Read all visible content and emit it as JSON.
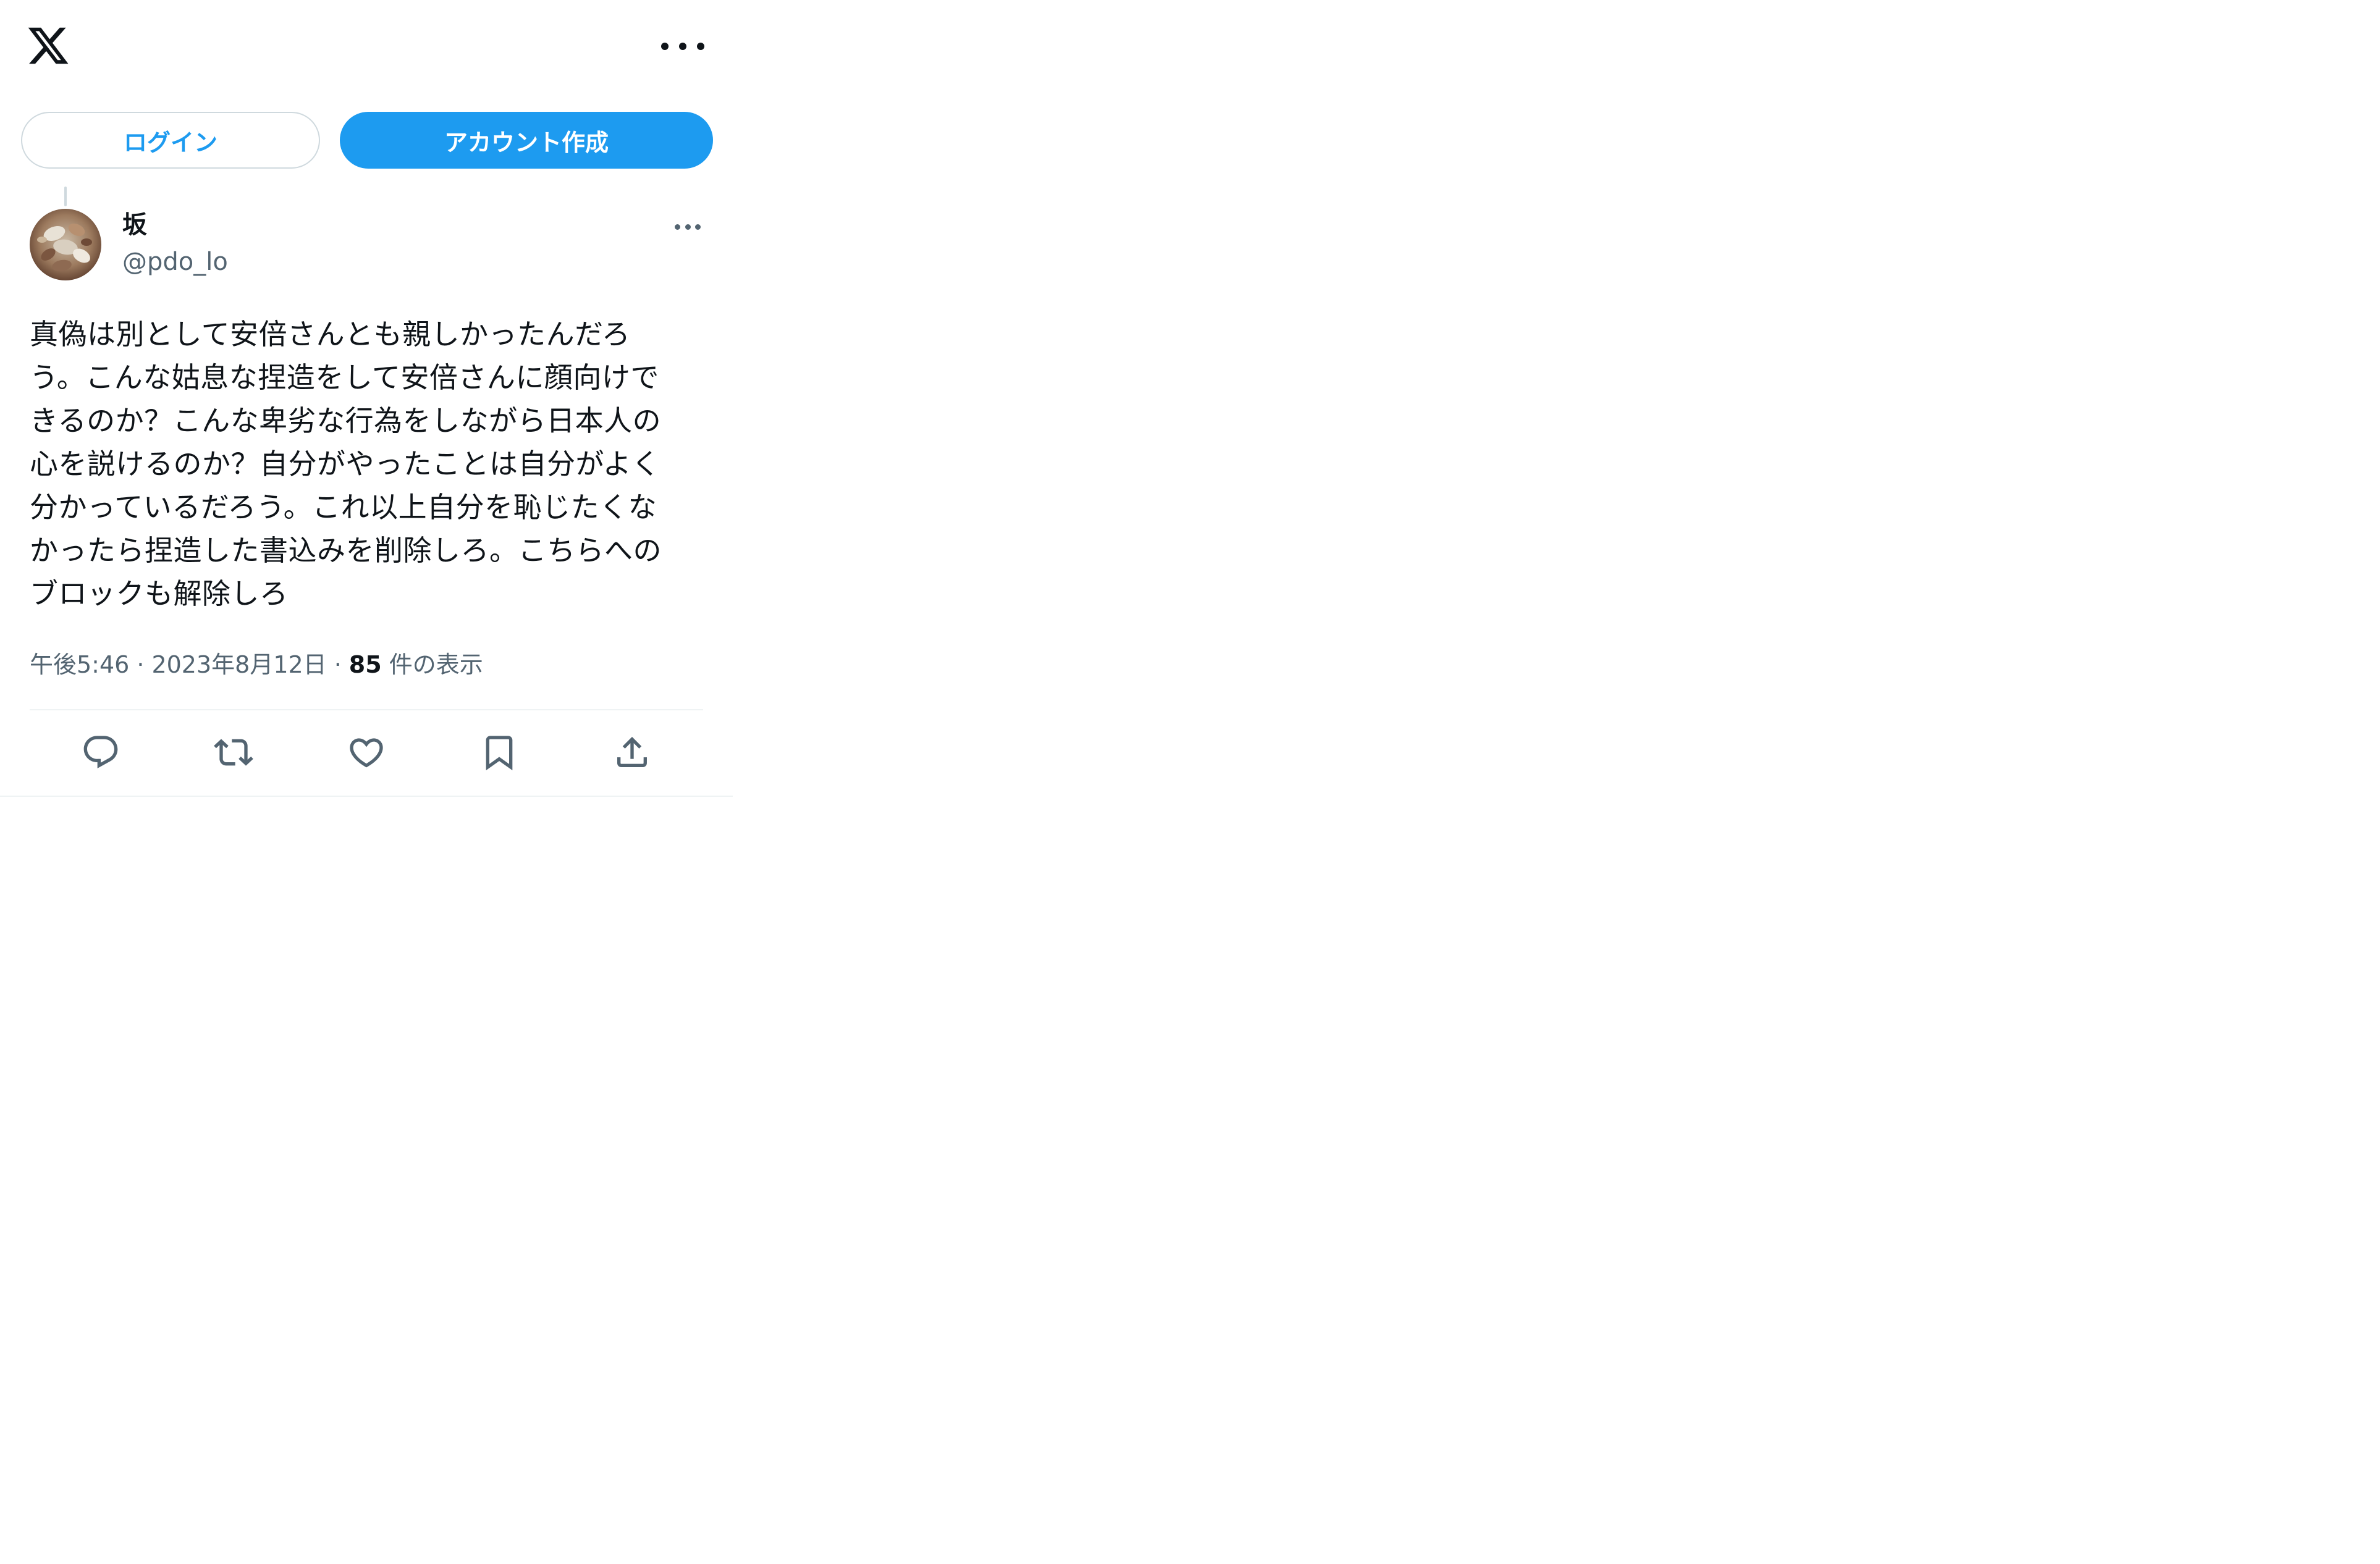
{
  "header": {
    "logo_icon": "x-logo-icon",
    "more_icon": "more-horizontal-icon"
  },
  "auth": {
    "login_label": "ログイン",
    "signup_label": "アカウント作成"
  },
  "tweet": {
    "display_name": "坂",
    "handle": "@pdo_lo",
    "text": "真偽は別として安倍さんとも親しかったんだろ\nう。こんな姑息な捏造をして安倍さんに顔向けで\nきるのか？こんな卑劣な行為をしながら日本人の\n心を説けるのか？自分がやったことは自分がよく\n分かっているだろう。これ以上自分を恥じたくな\nかったら捏造した書込みを削除しろ。こちらへの\nブロックも解除しろ",
    "time": "午後5:46",
    "date": "2023年8月12日",
    "separator": "·",
    "views_count": "85",
    "views_label": "件の表示"
  },
  "actions": [
    {
      "name": "reply",
      "icon": "reply-icon"
    },
    {
      "name": "retweet",
      "icon": "retweet-icon"
    },
    {
      "name": "like",
      "icon": "heart-icon"
    },
    {
      "name": "bookmark",
      "icon": "bookmark-icon"
    },
    {
      "name": "share",
      "icon": "share-icon"
    }
  ],
  "colors": {
    "accent": "#1d9bf0",
    "text": "#0f1419",
    "secondary": "#536471",
    "border": "#cfd9de"
  }
}
